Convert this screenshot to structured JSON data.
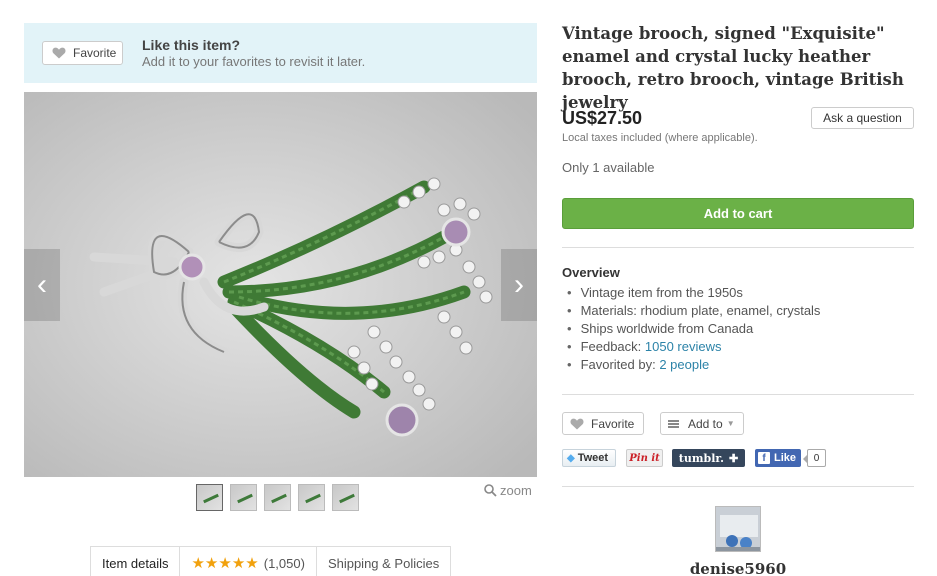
{
  "favorite_banner": {
    "button_label": "Favorite",
    "title": "Like this item?",
    "subtitle": "Add it to your favorites to revisit it later."
  },
  "gallery": {
    "prev_icon": "chevron-left-icon",
    "next_icon": "chevron-right-icon",
    "thumbnail_count": 5,
    "zoom_label": "zoom"
  },
  "tabs": [
    {
      "label": "Item details"
    },
    {
      "label": "(1,050)",
      "stars": "★★★★★"
    },
    {
      "label": "Shipping & Policies"
    }
  ],
  "listing": {
    "title": "Vintage brooch, signed \"Exquisite\" enamel and crystal lucky heather brooch, retro brooch, vintage British jewelry",
    "price": "US$27.50",
    "ask_label": "Ask a question",
    "taxes_note": "Local taxes included (where applicable).",
    "availability": "Only 1 available",
    "add_to_cart_label": "Add to cart"
  },
  "overview": {
    "heading": "Overview",
    "item1": "Vintage item from the 1950s",
    "item2": "Materials: rhodium plate, enamel, crystals",
    "item3": "Ships worldwide from Canada",
    "item4_prefix": "Feedback: ",
    "item4_link": "1050 reviews",
    "item5_prefix": "Favorited by: ",
    "item5_link": "2 people"
  },
  "actions": {
    "favorite_label": "Favorite",
    "add_to_label": "Add to"
  },
  "share": {
    "tweet": "Tweet",
    "pinit": "Pin it",
    "tumblr": "tumblr.",
    "tumblr_plus": "✚",
    "fb_like": "Like",
    "fb_count": "0"
  },
  "shop": {
    "name": "denise5960"
  },
  "colors": {
    "accent_green": "#6bb147",
    "banner_bg": "#e2f3f8",
    "link": "#2c83a8",
    "star": "#f1a10d"
  }
}
